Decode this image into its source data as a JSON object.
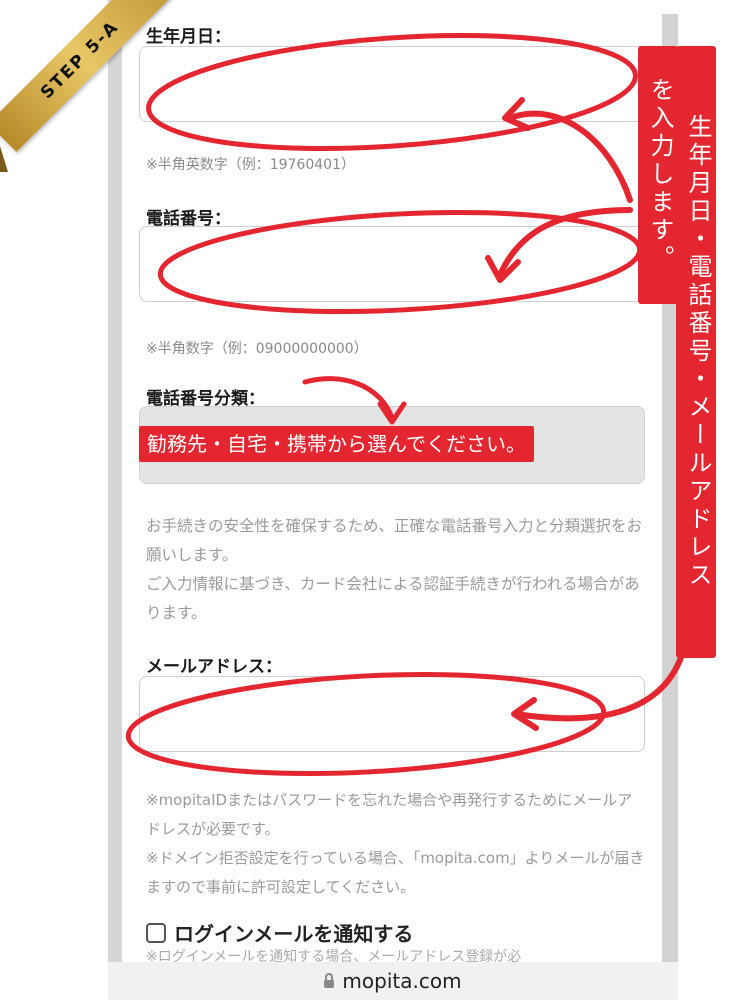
{
  "step_ribbon": "STEP 5-A",
  "form": {
    "birthday": {
      "label": "生年月日：",
      "hint": "※半角英数字（例：19760401）"
    },
    "phone": {
      "label": "電話番号：",
      "hint": "※半角数字（例：09000000000）"
    },
    "phone_type": {
      "label": "電話番号分類："
    },
    "security_note": "お手続きの安全性を確保するため、正確な電話番号入力と分類選択をお願いします。\nご入力情報に基づき、カード会社による認証手続きが行われる場合があります。",
    "email": {
      "label": "メールアドレス："
    },
    "email_note": "※mopitaIDまたはパスワードを忘れた場合や再発行するためにメールアドレスが必要です。\n※ドメイン拒否設定を行っている場合、「mopita.com」よりメールが届きますので事前に許可設定してください。",
    "login_mail": {
      "label": "ログインメールを通知する",
      "checked": false,
      "cut_text": "※ログインメールを通知する場合、メールアドレス登録が必"
    }
  },
  "annotations": {
    "phone_type_instruction": "勧務先・自宅・携帯から選んでください。",
    "vertical_right": "生年月日・電話番号・メールアドレス",
    "vertical_left": "を入力します。"
  },
  "browser": {
    "url": "mopita.com"
  },
  "colors": {
    "annotation_red": "#e3262f",
    "ribbon_gold": "#e8c766"
  }
}
